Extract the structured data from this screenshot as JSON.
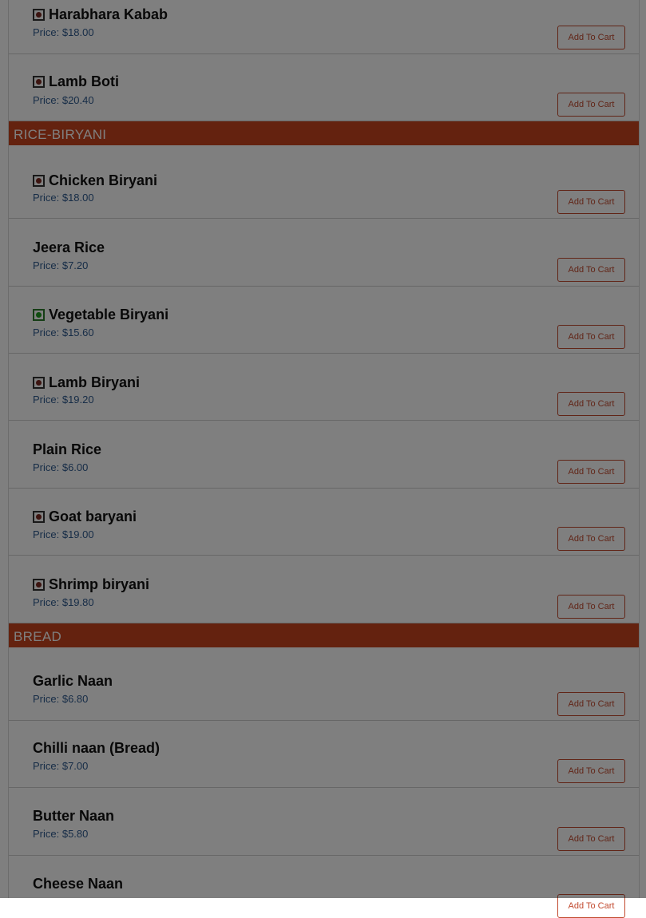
{
  "add_to_cart_label": "Add To Cart",
  "colors": {
    "category_bar": "#c9451e",
    "price_text": "#2f5a8f",
    "button_accent": "#c24a2f",
    "nonveg_dot": "#7a2a22",
    "veg_dot": "#1f9a1f",
    "overlay": "rgba(0,0,0,0.5)"
  },
  "sections": [
    {
      "category": "",
      "items": [
        {
          "name": "Harabhara Kabab",
          "price": "Price: $18.00",
          "diet_icon": "nonveg-mark-icon"
        },
        {
          "name": "Lamb Boti",
          "price": "Price: $20.40",
          "diet_icon": "nonveg-mark-icon"
        }
      ]
    },
    {
      "category": "RICE-BIRYANI",
      "items": [
        {
          "name": "Chicken Biryani",
          "price": "Price: $18.00",
          "diet_icon": "nonveg-mark-icon"
        },
        {
          "name": "Jeera Rice",
          "price": "Price: $7.20",
          "diet_icon": ""
        },
        {
          "name": "Vegetable Biryani",
          "price": "Price: $15.60",
          "diet_icon": "veg-mark-icon"
        },
        {
          "name": "Lamb Biryani",
          "price": "Price: $19.20",
          "diet_icon": "nonveg-mark-icon"
        },
        {
          "name": "Plain Rice",
          "price": "Price: $6.00",
          "diet_icon": ""
        },
        {
          "name": "Goat baryani",
          "price": "Price: $19.00",
          "diet_icon": "nonveg-mark-icon"
        },
        {
          "name": "Shrimp biryani",
          "price": "Price: $19.80",
          "diet_icon": "nonveg-mark-icon"
        }
      ]
    },
    {
      "category": "BREAD",
      "items": [
        {
          "name": "Garlic Naan",
          "price": "Price: $6.80",
          "diet_icon": ""
        },
        {
          "name": "Chilli naan (Bread)",
          "price": "Price: $7.00",
          "diet_icon": ""
        },
        {
          "name": "Butter Naan",
          "price": "Price: $5.80",
          "diet_icon": ""
        },
        {
          "name": "Cheese Naan",
          "price": "",
          "diet_icon": ""
        }
      ]
    }
  ]
}
